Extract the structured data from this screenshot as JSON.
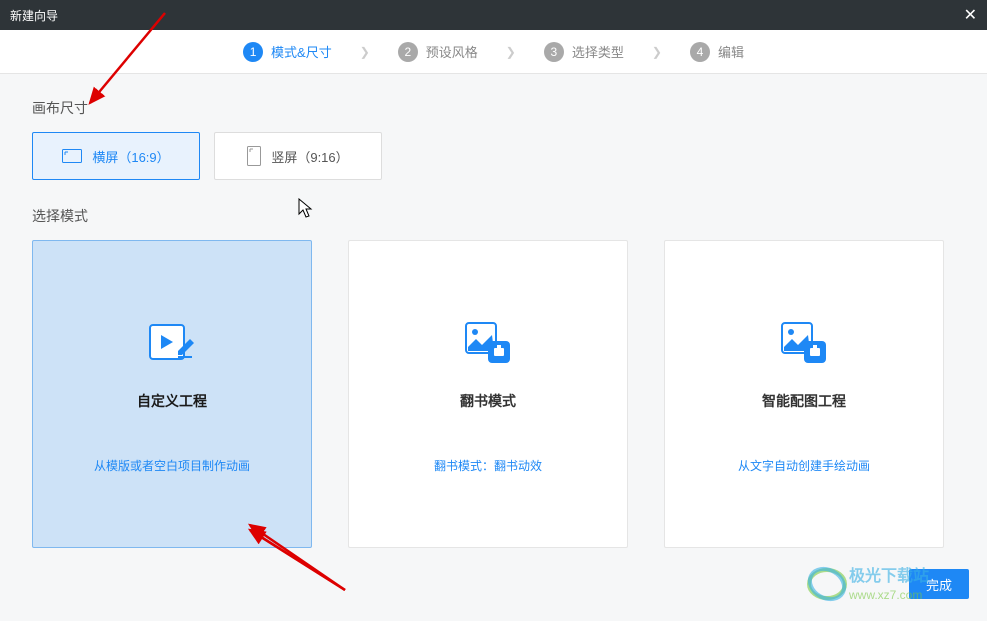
{
  "titlebar": {
    "title": "新建向导"
  },
  "stepper": {
    "steps": [
      {
        "num": "1",
        "label": "模式&尺寸"
      },
      {
        "num": "2",
        "label": "预设风格"
      },
      {
        "num": "3",
        "label": "选择类型"
      },
      {
        "num": "4",
        "label": "编辑"
      }
    ]
  },
  "canvas": {
    "label": "画布尺寸",
    "landscape": "横屏（16:9）",
    "portrait": "竖屏（9:16）"
  },
  "mode": {
    "label": "选择模式",
    "cards": [
      {
        "title": "自定义工程",
        "desc": "从模版或者空白项目制作动画"
      },
      {
        "title": "翻书模式",
        "desc": "翻书模式：翻书动效"
      },
      {
        "title": "智能配图工程",
        "desc": "从文字自动创建手绘动画"
      }
    ]
  },
  "footer": {
    "finish": "完成"
  },
  "watermark": {
    "line1": "极光下载站",
    "line2": "www.xz7.com"
  }
}
